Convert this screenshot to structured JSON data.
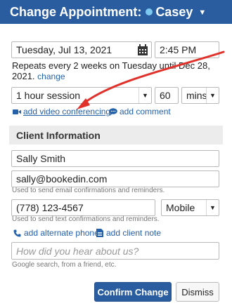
{
  "header": {
    "title": "Change Appointment:",
    "client_name": "Casey",
    "status_dot_color": "#7cc8ee"
  },
  "schedule": {
    "date": "Tuesday, Jul 13, 2021",
    "time": "2:45 PM",
    "repeat_text": "Repeats every 2 weeks on Tuesday until Dec 28, 2021.",
    "change_link": "change"
  },
  "session": {
    "type": "1 hour session",
    "duration": "60",
    "unit": "mins"
  },
  "links": {
    "video": "add video conferencing",
    "comment": "add comment",
    "alt_phone": "add alternate phone",
    "client_note": "add client note"
  },
  "client_info": {
    "heading": "Client Information",
    "name": "Sally Smith",
    "email": "sally@bookedin.com",
    "email_hint": "Used to send email confirmations and reminders.",
    "phone": "(778) 123-4567",
    "phone_type": "Mobile",
    "phone_hint": "Used to send text confirmations and reminders.",
    "referral_placeholder": "How did you hear about us?",
    "referral_hint": "Google search, from a friend, etc."
  },
  "buttons": {
    "confirm": "Confirm Change",
    "dismiss": "Dismiss"
  },
  "colors": {
    "header_bg": "#2a5da0",
    "link": "#2561a8",
    "annotation_arrow": "#e0312b"
  }
}
